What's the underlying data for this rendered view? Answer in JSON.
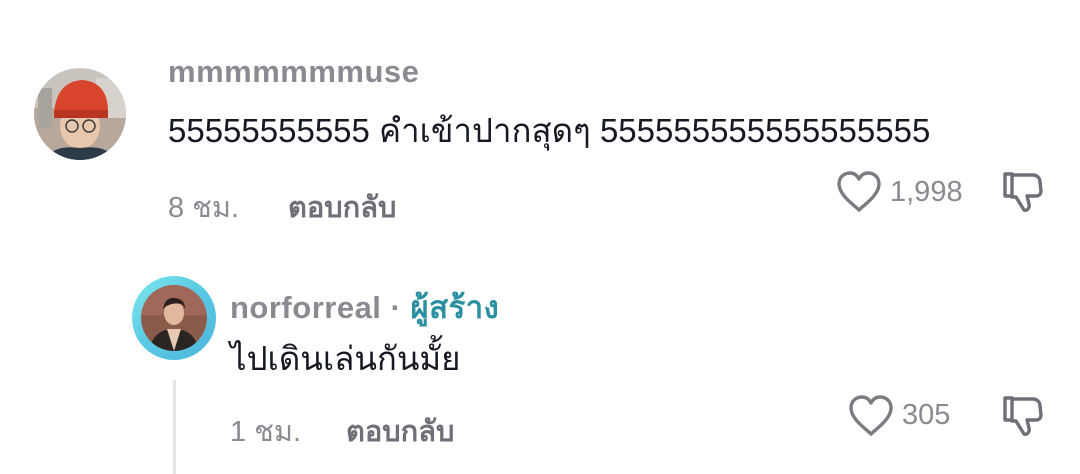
{
  "comments": [
    {
      "username": "mmmmmmmuse",
      "text": "55555555555 คำเข้าปากสุดๆ 555555555555555555",
      "time": "8 ชม.",
      "reply_label": "ตอบกลับ",
      "like_count": "1,998"
    }
  ],
  "reply": {
    "username": "norforreal",
    "separator": "·",
    "badge": "ผู้สร้าง",
    "text": "ไปเดินเล่นกันมั้ย",
    "time": "1 ชม.",
    "reply_label": "ตอบกลับ",
    "like_count": "305"
  },
  "icons": {
    "like": "heart-outline-icon",
    "dislike": "thumbs-down-icon"
  },
  "colors": {
    "text_primary": "#161823",
    "text_secondary": "#8a8b91",
    "creator_badge": "#2a8fa1",
    "avatar_ring": "#58c9e2"
  }
}
